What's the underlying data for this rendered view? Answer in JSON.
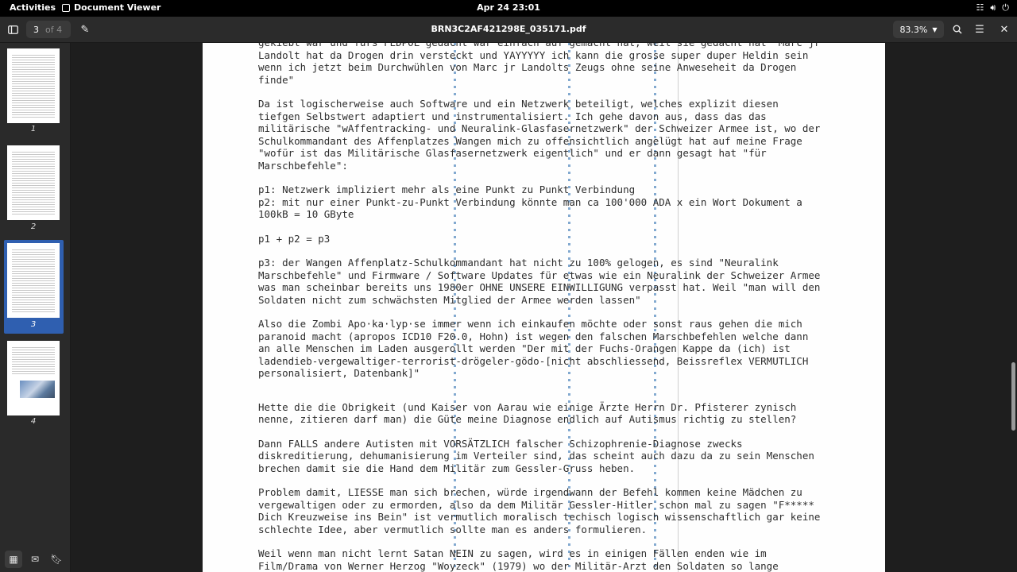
{
  "topbar": {
    "activities": "Activities",
    "app_name": "Document Viewer",
    "datetime": "Apr 24  23:01"
  },
  "header": {
    "current_page": "3",
    "page_total": "of 4",
    "document_title": "BRN3C2AF421298E_035171.pdf",
    "zoom": "83.3%"
  },
  "sidebar": {
    "thumbnails": [
      {
        "label": "1"
      },
      {
        "label": "2"
      },
      {
        "label": "3",
        "selected": true
      },
      {
        "label": "4"
      }
    ]
  },
  "document": {
    "paragraphs": [
      "gekiebt war und furs FEDPOL gedacht war einfach auf gemacht hat, weil sie gedacht hat \"Marc jr\nLandolt hat da Drogen drin versteckt und YAYYYYY ich kann die grosse super duper Heldin sein\nwenn ich jetzt beim Durchwühlen von Marc jr Landolts Zeugs ohne seine Anweseheit da Drogen\nfinde\"",
      "Da ist logischerweise auch Software und ein Netzwerk beteiligt, welches explizit diesen\ntiefgen Selbstwert adaptiert und instrumentalisiert. Ich gehe davon aus, dass das das\nmilitärische \"wAffentracking- und Neuralink-Glasfasernetzwerk\" der Schweizer Armee ist, wo der\nSchulkommandant des Affenplatzes Wangen mich zu offensichtlich angelügt hat auf meine Frage\n\"wofür ist das Militärische Glasfasernetzwerk eigentlich\" und er dann gesagt hat \"für\nMarschbefehle\":",
      "p1: Netzwerk impliziert mehr als eine Punkt zu Punkt Verbindung\np2: mit nur einer Punkt-zu-Punkt Verbindung könnte man ca 100'000 ADA x ein Wort Dokument a\n100kB = 10 GByte",
      "p1 + p2 = p3",
      "p3: der Wangen Affenplatz-Schulkommandant hat nicht zu 100% gelogen, es sind \"Neuralink\nMarschbefehle\" und Firmware / Software Updates für etwas wie ein Neuralink der Schweizer Armee\nwas man scheinbar bereits uns 1980er OHNE UNSERE EINWILLIGUNG verpasst hat. Weil \"man will den\nSoldaten nicht zum schwächsten Mitglied der Armee werden lassen\"",
      "Also die Zombi Apo·ka·lyp·se immer wenn ich einkaufen möchte oder sonst raus gehen die mich\nparanoid macht (apropos ICD10 F20.0, Hohn) ist wegen den falschen Marschbefehlen welche dann\nan alle Menschen im Laden ausgerollt werden \"Der mit der Fuchs-Orangen Kappe da (ich) ist\nladendieb-vergewaltiger-terrorist-drögeler-gödo-[nicht abschliessend, Beissreflex VERMUTLICH\npersonalisiert, Datenbank]\"",
      "Hette die die Obrigkeit (und Kaiser von Aarau wie einige Ärzte Herrn Dr. Pfisterer zynisch\nnenne, zitieren darf man) die Güte meine Diagnose endlich auf Autismus richtig zu stellen?",
      "Dann FALLS andere Autisten mit VORSÄTZLICH falscher Schizophrenie-Diagnose zwecks\ndiskreditierung, dehumanisierung im Verteiler sind, das scheint auch dazu da zu sein Menschen\nbrechen damit sie die Hand dem Militär zum Gessler-Gruss heben.",
      "Problem damit, LIESSE man sich brechen, würde irgendwann der Befehl kommen keine Mädchen zu\nvergewaltigen oder zu ermorden, also da dem Militär Gessler-Hitler schon mal zu sagen \"F*****\nDich Kreuzweise ins Bein\" ist vermutlich moralisch techisch logisch wissenschaftlich gar keine\nschlechte Idee, aber vermutlich sollte man es anders formulieren.",
      "Weil wenn man nicht lernt Satan NEIN zu sagen, wird es in einigen Fällen enden wie im\nFilm/Drama von Werner Herzog \"Woyzeck\" (1979) wo der Militär-Arzt den Soldaten so lange"
    ]
  }
}
